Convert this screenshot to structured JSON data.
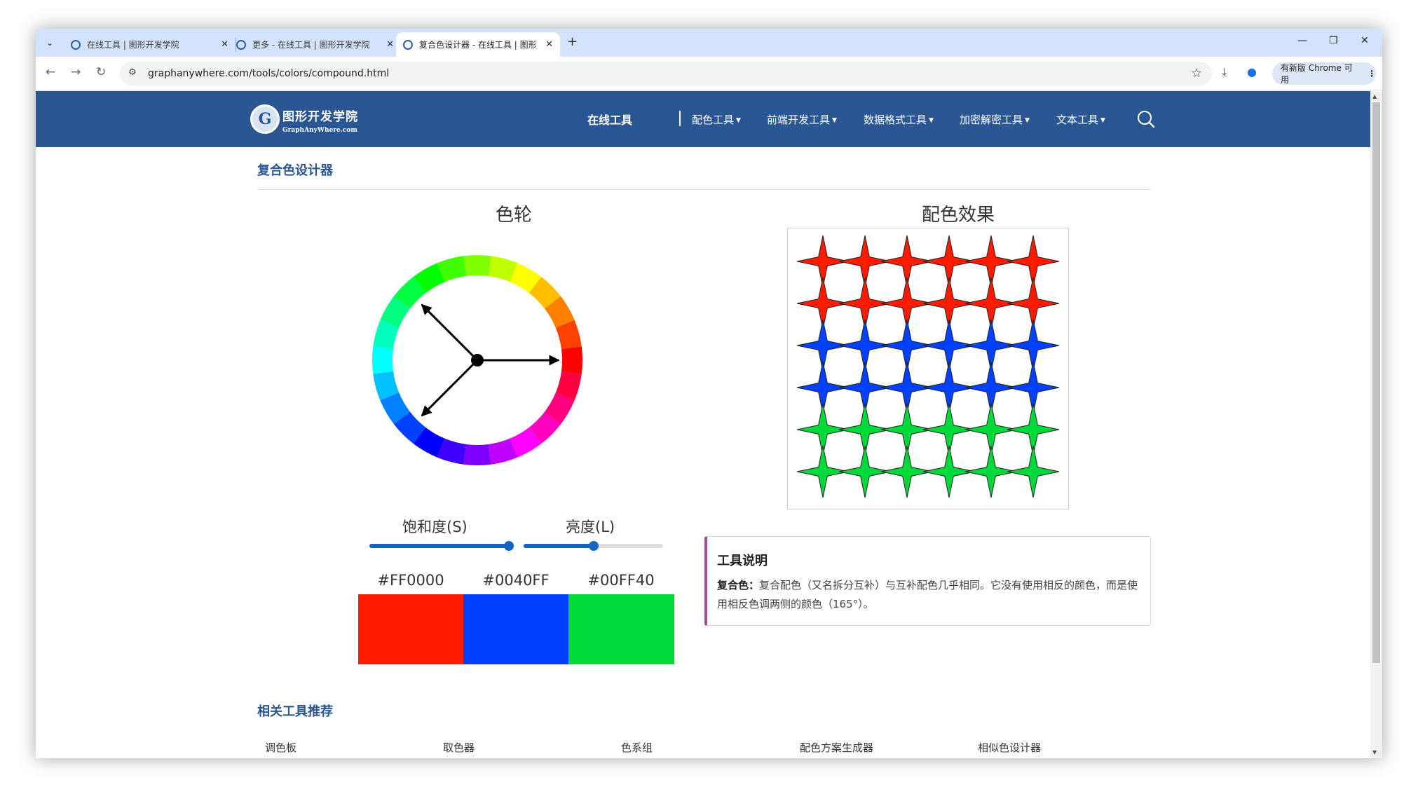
{
  "browser": {
    "tabs": [
      {
        "title": "在线工具 | 图形开发学院",
        "active": false
      },
      {
        "title": "更多 - 在线工具 | 图形开发学院",
        "active": false
      },
      {
        "title": "复合色设计器 - 在线工具 | 图形",
        "active": true
      }
    ],
    "new_tab": "+",
    "url": "graphanywhere.com/tools/colors/compound.html",
    "update_label": "有新版 Chrome 可用"
  },
  "site": {
    "brand_cn": "图形开发学院",
    "brand_en": "GraphAnyWhere.com",
    "logo_letter": "G",
    "nav_main": "在线工具",
    "nav_items": [
      "配色工具",
      "前端开发工具",
      "数据格式工具",
      "加密解密工具",
      "文本工具"
    ]
  },
  "page": {
    "title": "复合色设计器",
    "wheel_heading": "色轮",
    "effect_heading": "配色效果",
    "saturation_label": "饱和度(S)",
    "lightness_label": "亮度(L)",
    "saturation_value": 1.0,
    "lightness_value": 0.5
  },
  "colors": [
    {
      "hex": "#FF0000",
      "swatch": "#ff1a00"
    },
    {
      "hex": "#0040FF",
      "swatch": "#0040ff"
    },
    {
      "hex": "#00FF40",
      "swatch": "#00d93a"
    }
  ],
  "description": {
    "title": "工具说明",
    "term": "复合色：",
    "text": "复合配色（又名拆分互补）与互补配色几乎相同。它没有使用相反的颜色，而是使用相反色调两侧的颜色（165°）。"
  },
  "related": {
    "title": "相关工具推荐",
    "items": [
      "调色板",
      "取色器",
      "色系组",
      "配色方案生成器",
      "相似色设计器"
    ]
  },
  "wheel": {
    "pointer_angles_deg": [
      0,
      135,
      225
    ]
  },
  "pattern": {
    "rows": 6,
    "cols": 6,
    "row_colors": [
      "#ff1a00",
      "#ff1a00",
      "#0040ff",
      "#0040ff",
      "#00d93a",
      "#00d93a"
    ]
  }
}
